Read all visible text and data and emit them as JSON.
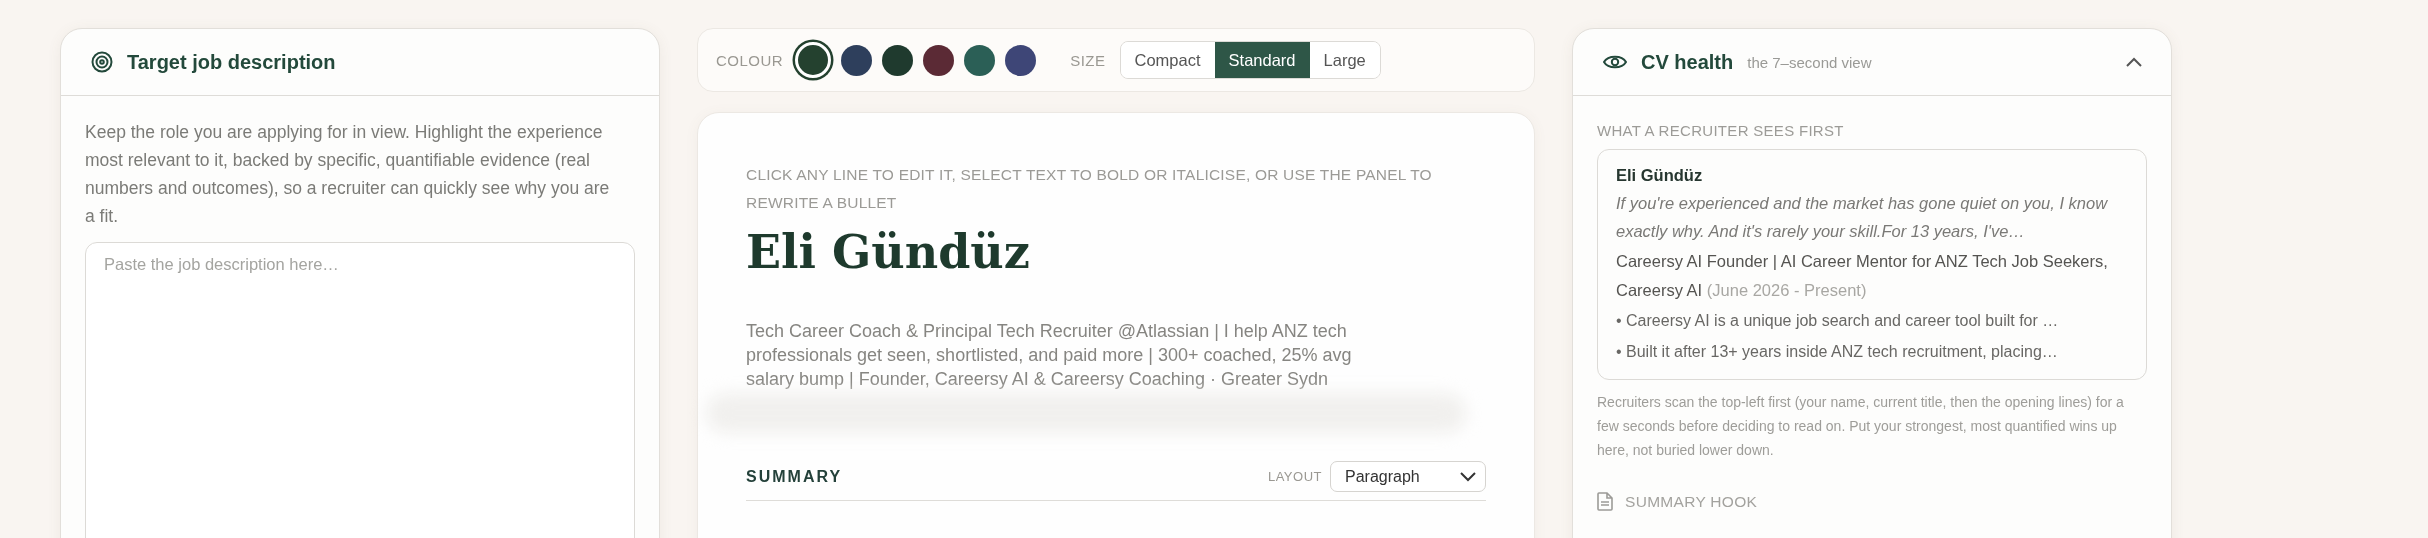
{
  "job_panel": {
    "title": "Target job description",
    "intro": "Keep the role you are applying for in view. Highlight the experience most relevant to it, backed by specific, quantifiable evidence (real numbers and outcomes), so a recruiter can quickly see why you are a fit.",
    "field": {
      "placeholder": "Paste the job description here…"
    }
  },
  "toolbar": {
    "colour_label": "COLOUR",
    "swatches": [
      {
        "color": "#24412f",
        "selected": true
      },
      {
        "color": "#2e3f5c",
        "selected": false
      },
      {
        "color": "#1f3a2e",
        "selected": false
      },
      {
        "color": "#5b2a35",
        "selected": false
      },
      {
        "color": "#2b5f56",
        "selected": false
      },
      {
        "color": "#3e4677",
        "selected": false
      }
    ],
    "size_label": "SIZE",
    "sizes": [
      {
        "label": "Compact",
        "selected": false
      },
      {
        "label": "Standard",
        "selected": true
      },
      {
        "label": "Large",
        "selected": false
      }
    ]
  },
  "cv": {
    "hint": "CLICK ANY LINE TO EDIT IT, SELECT TEXT TO BOLD OR ITALICISE, OR USE THE PANEL TO REWRITE A BULLET",
    "name": "Eli Gündüz",
    "headline": "Tech Career Coach & Principal Tech Recruiter @Atlassian | I help ANZ tech professionals get seen, shortlisted, and paid more | 300+ coached, 25% avg salary bump | Founder, Careersy AI & Careersy Coaching · Greater Sydn",
    "section": "SUMMARY",
    "layout_label": "LAYOUT",
    "layout_value": "Paragraph"
  },
  "health_panel": {
    "title": "CV health",
    "subtitle": "the 7–second view",
    "expanded": true,
    "label": "WHAT A RECRUITER SEES FIRST",
    "preview": {
      "name": "Eli Gündüz",
      "quote": "If you're experienced and the market has gone quiet on you, I know exactly why. And it's rarely your skill.For 13 years, I've…",
      "role": "Careersy AI Founder | AI Career Mentor for ANZ Tech Job Seekers, Careersy AI",
      "dates": "(June 2026 - Present)",
      "bullets": [
        "• Careersy AI is a unique job search and career tool built for …",
        "• Built it after 13+ years inside ANZ tech recruitment, placing…"
      ]
    },
    "note": "Recruiters scan the top-left first (your name, current title, then the opening lines) for a few seconds before deciding to read on. Put your strongest, most quantified wins up here, not buried lower down.",
    "next_section": "SUMMARY HOOK"
  }
}
